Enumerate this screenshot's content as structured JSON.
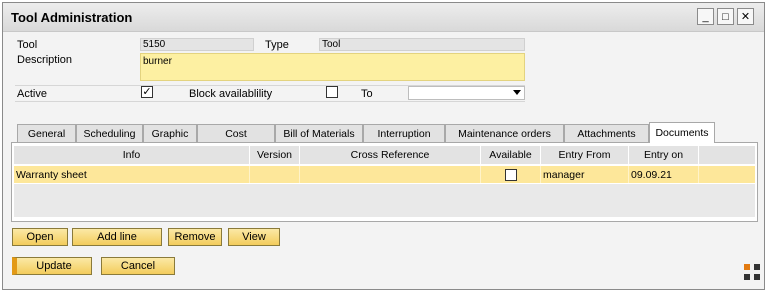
{
  "window": {
    "title": "Tool Administration",
    "controls": {
      "minimize": "_",
      "maximize": "□",
      "close": "✕"
    }
  },
  "form": {
    "tool_label": "Tool",
    "tool_value": "5150",
    "type_label": "Type",
    "type_value": "Tool",
    "description_label": "Description",
    "description_value": "burner",
    "active_label": "Active",
    "active_checked": "✓",
    "block_label": "Block availablility",
    "to_label": "To",
    "to_value": ""
  },
  "tabs": [
    {
      "label": "General"
    },
    {
      "label": "Scheduling"
    },
    {
      "label": "Graphic"
    },
    {
      "label": "Cost"
    },
    {
      "label": "Bill of Materials"
    },
    {
      "label": "Interruption"
    },
    {
      "label": "Maintenance orders"
    },
    {
      "label": "Attachments"
    },
    {
      "label": "Documents",
      "active": true
    }
  ],
  "grid": {
    "columns": [
      "Info",
      "Version",
      "Cross Reference",
      "Available",
      "Entry From",
      "Entry on"
    ],
    "rows": [
      {
        "info": "Warranty sheet",
        "version": "",
        "cross_reference": "",
        "available": "",
        "entry_from": "manager",
        "entry_on": "09.09.21"
      }
    ]
  },
  "actions": {
    "open": "Open",
    "add_line": "Add line",
    "remove": "Remove",
    "view": "View"
  },
  "footer": {
    "update": "Update",
    "cancel": "Cancel"
  },
  "colors": {
    "accent": "#f3cc5c",
    "field_highlight": "#fdf0a2",
    "selected_row": "#fde79a"
  }
}
